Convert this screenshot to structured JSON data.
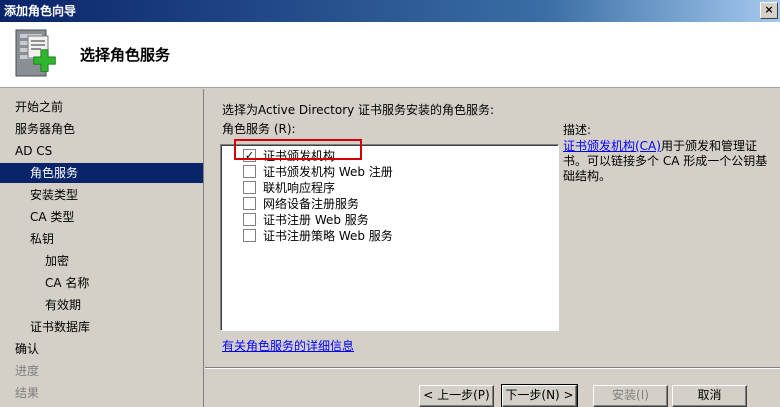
{
  "window": {
    "title": "添加角色向导",
    "close_label": "×"
  },
  "header": {
    "title": "选择角色服务"
  },
  "nav": {
    "items": [
      {
        "label": "开始之前",
        "state": "normal"
      },
      {
        "label": "服务器角色",
        "state": "normal"
      },
      {
        "label": "AD CS",
        "state": "normal"
      },
      {
        "label": "角色服务",
        "state": "selected"
      },
      {
        "label": "安装类型",
        "state": "normal"
      },
      {
        "label": "CA 类型",
        "state": "normal"
      },
      {
        "label": "私钥",
        "state": "normal"
      },
      {
        "label": "加密",
        "state": "normal"
      },
      {
        "label": "CA 名称",
        "state": "normal"
      },
      {
        "label": "有效期",
        "state": "normal"
      },
      {
        "label": "证书数据库",
        "state": "normal"
      },
      {
        "label": "确认",
        "state": "normal"
      },
      {
        "label": "进度",
        "state": "disabled"
      },
      {
        "label": "结果",
        "state": "disabled"
      }
    ]
  },
  "main": {
    "instruction": "选择为Active Directory 证书服务安装的角色服务:",
    "list_label": "角色服务 (R):",
    "role_services": [
      {
        "label": "证书颁发机构",
        "checked": true
      },
      {
        "label": "证书颁发机构 Web 注册",
        "checked": false
      },
      {
        "label": "联机响应程序",
        "checked": false
      },
      {
        "label": "网络设备注册服务",
        "checked": false
      },
      {
        "label": "证书注册 Web 服务",
        "checked": false
      },
      {
        "label": "证书注册策略 Web 服务",
        "checked": false
      }
    ],
    "check_mark": "✓",
    "more_info_link": "有关角色服务的详细信息",
    "description_label": "描述:",
    "description_link": "证书颁发机构(CA)",
    "description_text": "用于颁发和管理证书。可以链接多个 CA 形成一个公钥基础结构。"
  },
  "buttons": {
    "back": "< 上一步(P)",
    "next": "下一步(N) >",
    "install": "安装(I)",
    "cancel": "取消"
  },
  "colors": {
    "selection": "#0a246a",
    "highlight_box": "#d40000",
    "link": "#0000ff"
  }
}
